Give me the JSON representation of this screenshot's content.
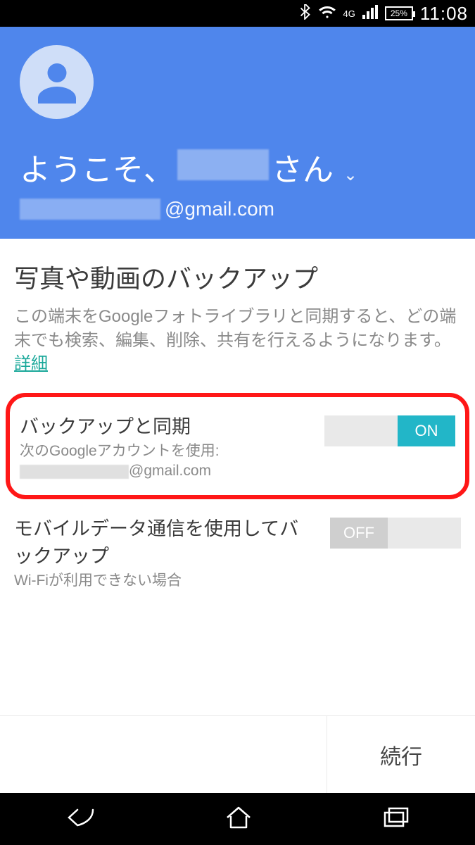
{
  "status": {
    "network_label": "4G",
    "battery_pct": "25%",
    "clock": "11:08"
  },
  "hero": {
    "welcome_prefix": "ようこそ、",
    "welcome_suffix": "さん",
    "email_domain": "@gmail.com"
  },
  "section": {
    "title": "写真や動画のバックアップ",
    "description": "この端末をGoogleフォトライブラリと同期すると、どの端末でも検索、編集、削除、共有を行えるようになります。",
    "details_link": "詳細"
  },
  "settings": {
    "backup_sync": {
      "title": "バックアップと同期",
      "subtitle_prefix": "次のGoogleアカウントを使用:",
      "account_domain": "@gmail.com",
      "toggle_label": "ON",
      "toggle_state": "on"
    },
    "mobile_data": {
      "title": "モバイルデータ通信を使用してバックアップ",
      "subtitle": "Wi-Fiが利用できない場合",
      "toggle_label": "OFF",
      "toggle_state": "off"
    }
  },
  "footer": {
    "continue": "続行"
  }
}
